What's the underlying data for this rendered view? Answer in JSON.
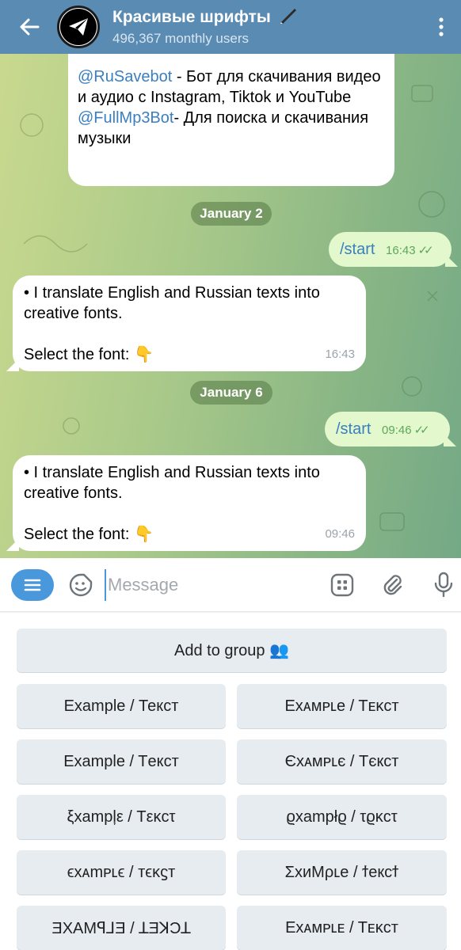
{
  "header": {
    "title": "Красивые шрифты",
    "subtitle": "496,367 monthly users"
  },
  "messages": {
    "first_bubble": {
      "link1": "@RuSavebot",
      "text1": " - Бот для скачивания видео и аудио с Instagram, Tiktok и YouTube",
      "link2": "@FullMp3Bot",
      "text2": "- Для поиска и скачивания музыки"
    },
    "date1": "January 2",
    "out1": {
      "text": "/start",
      "time": "16:43"
    },
    "in1": {
      "line1": "• I translate English and Russian texts into creative fonts.",
      "line2": "Select the font: 👇",
      "time": "16:43"
    },
    "date2": "January 6",
    "out2": {
      "text": "/start",
      "time": "09:46"
    },
    "in2": {
      "line1": "• I translate English and Russian texts into creative fonts.",
      "line2": "Select the font: 👇",
      "time": "09:46"
    }
  },
  "composer": {
    "placeholder": "Message"
  },
  "keyboard": {
    "add_to_group": "Add to group 👥",
    "buttons": [
      "Example / Текст",
      "Eхᴀмᴘʟe / Tᴇᴋᴄᴛ",
      "Exаmple / Tекст",
      "Єxᴀмᴘʟє / Tєкcт",
      "ξxampļε / Tεĸcτ",
      "ϱxampłϱ / τϱκcτ",
      "ϵxᴀmᴘʟϵ / ᴛϵᴋϛᴛ",
      "ΣxᴎMρʟe / ϯeкcϯ",
      "ƎXAMꟼ⅃Ǝ / ꓕƎꓘƆꓕ",
      "Exᴀᴍᴘʟᴇ / Tᴇᴋᴄᴛ"
    ]
  },
  "colors": {
    "header_bg": "#5a8bb3",
    "link": "#3a7fbf",
    "outgoing_bubble": "#e3f8cd",
    "accent": "#4a98dc"
  }
}
